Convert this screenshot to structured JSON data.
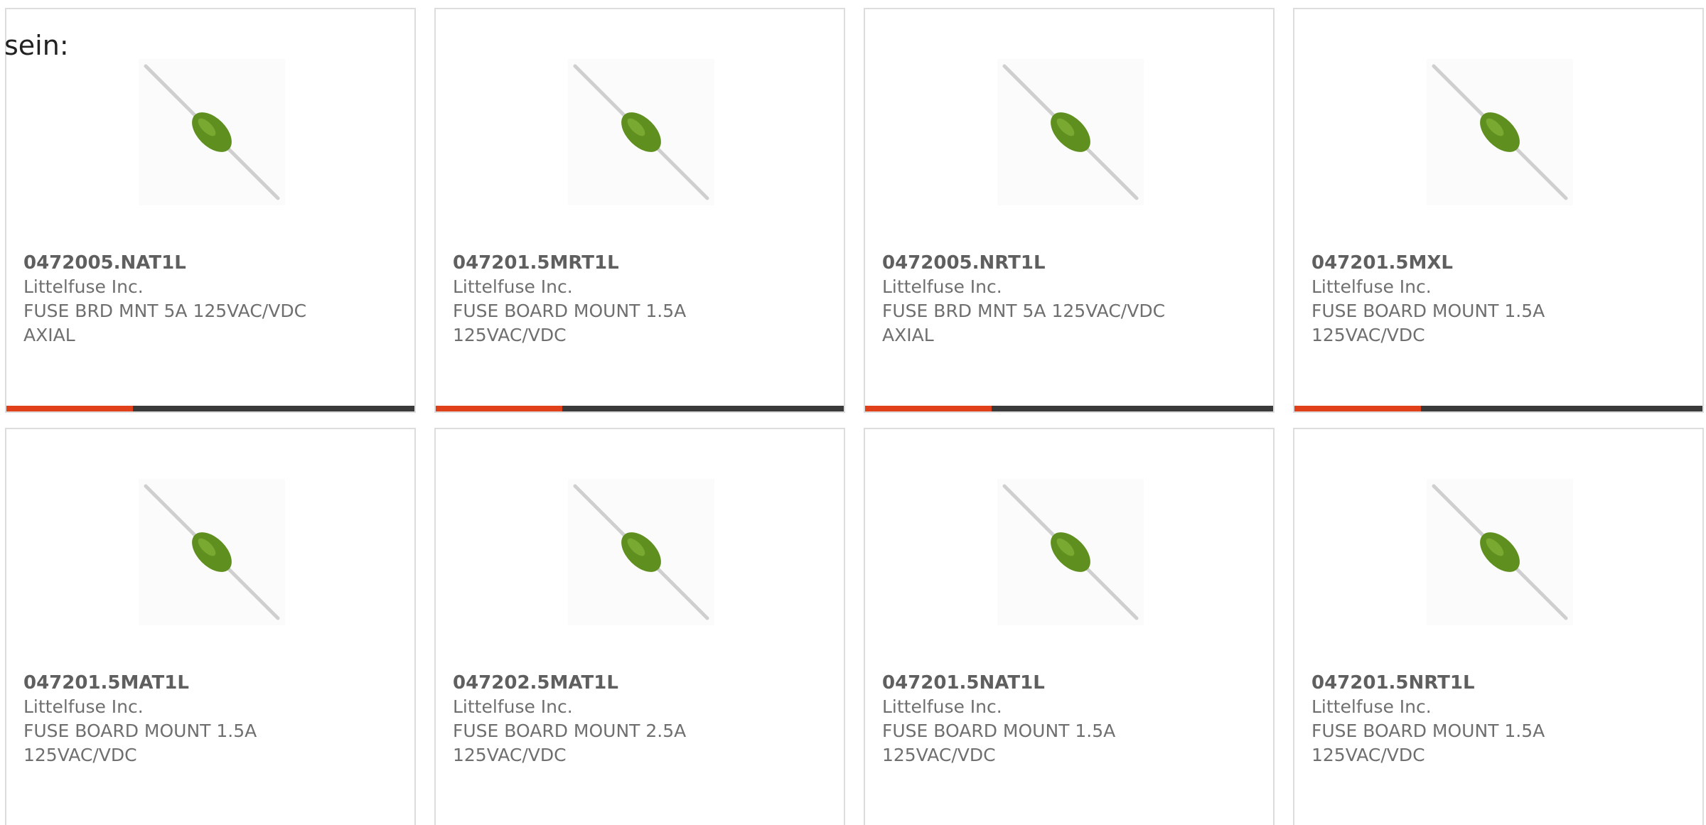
{
  "intro": {
    "text": "sein:"
  },
  "products": [
    {
      "part_number": "0472005.NAT1L",
      "manufacturer": "Littelfuse Inc.",
      "description_line1": "FUSE BRD MNT 5A 125VAC/VDC",
      "description_line2": "AXIAL",
      "image_icon": "axial-fuse-icon",
      "progress": 0.31
    },
    {
      "part_number": "047201.5MRT1L",
      "manufacturer": "Littelfuse Inc.",
      "description_line1": "FUSE BOARD MOUNT 1.5A",
      "description_line2": "125VAC/VDC",
      "image_icon": "axial-fuse-icon",
      "progress": 0.31
    },
    {
      "part_number": "0472005.NRT1L",
      "manufacturer": "Littelfuse Inc.",
      "description_line1": "FUSE BRD MNT 5A 125VAC/VDC",
      "description_line2": "AXIAL",
      "image_icon": "axial-fuse-icon",
      "progress": 0.31
    },
    {
      "part_number": "047201.5MXL",
      "manufacturer": "Littelfuse Inc.",
      "description_line1": "FUSE BOARD MOUNT 1.5A",
      "description_line2": "125VAC/VDC",
      "image_icon": "axial-fuse-icon",
      "progress": 0.31
    },
    {
      "part_number": "047201.5MAT1L",
      "manufacturer": "Littelfuse Inc.",
      "description_line1": "FUSE BOARD MOUNT 1.5A",
      "description_line2": "125VAC/VDC",
      "image_icon": "axial-fuse-icon"
    },
    {
      "part_number": "047202.5MAT1L",
      "manufacturer": "Littelfuse Inc.",
      "description_line1": "FUSE BOARD MOUNT 2.5A",
      "description_line2": "125VAC/VDC",
      "image_icon": "axial-fuse-icon"
    },
    {
      "part_number": "047201.5NAT1L",
      "manufacturer": "Littelfuse Inc.",
      "description_line1": "FUSE BOARD MOUNT 1.5A",
      "description_line2": "125VAC/VDC",
      "image_icon": "axial-fuse-icon"
    },
    {
      "part_number": "047201.5NRT1L",
      "manufacturer": "Littelfuse Inc.",
      "description_line1": "FUSE BOARD MOUNT 1.5A",
      "description_line2": "125VAC/VDC",
      "image_icon": "axial-fuse-icon"
    }
  ],
  "colors": {
    "progress_fill": "#e0401a",
    "progress_track": "#3a3a3a",
    "fuse_body": "#5f8f1f",
    "lead_wire": "#c9c9c9",
    "card_border": "#dddddd"
  }
}
